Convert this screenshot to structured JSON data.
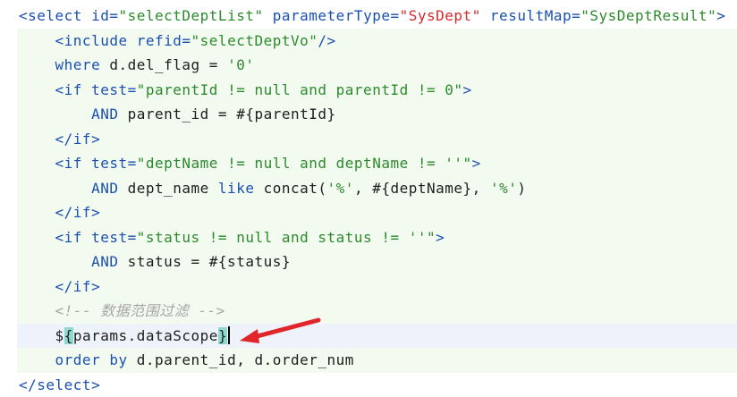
{
  "code": {
    "lines": [
      {
        "segments": [
          {
            "t": "<select ",
            "c": "tag"
          },
          {
            "t": "id=",
            "c": "attr"
          },
          {
            "t": "\"selectDeptList\" ",
            "c": "str"
          },
          {
            "t": "parameterType=",
            "c": "attr"
          },
          {
            "t": "\"SysDept\" ",
            "c": "red"
          },
          {
            "t": "resultMap=",
            "c": "attr"
          },
          {
            "t": "\"SysDeptResult\"",
            "c": "str"
          },
          {
            "t": ">",
            "c": "tag"
          }
        ]
      },
      {
        "segments": [
          {
            "t": "    <include ",
            "c": "tag"
          },
          {
            "t": "refid=",
            "c": "attr"
          },
          {
            "t": "\"selectDeptVo\"",
            "c": "str"
          },
          {
            "t": "/>",
            "c": "tag"
          }
        ]
      },
      {
        "segments": [
          {
            "t": "    where ",
            "c": "kw"
          },
          {
            "t": "d.del_flag = ",
            "c": "plain"
          },
          {
            "t": "'0'",
            "c": "str"
          }
        ]
      },
      {
        "segments": [
          {
            "t": "    <if ",
            "c": "tag"
          },
          {
            "t": "test=",
            "c": "attr"
          },
          {
            "t": "\"parentId != null and parentId != 0\"",
            "c": "str"
          },
          {
            "t": ">",
            "c": "tag"
          }
        ]
      },
      {
        "segments": [
          {
            "t": "        AND ",
            "c": "kw"
          },
          {
            "t": "parent_id = #{parentId}",
            "c": "plain"
          }
        ]
      },
      {
        "segments": [
          {
            "t": "    </if>",
            "c": "tag"
          }
        ]
      },
      {
        "segments": [
          {
            "t": "    <if ",
            "c": "tag"
          },
          {
            "t": "test=",
            "c": "attr"
          },
          {
            "t": "\"deptName != null and deptName != ''\"",
            "c": "str"
          },
          {
            "t": ">",
            "c": "tag"
          }
        ]
      },
      {
        "segments": [
          {
            "t": "        AND ",
            "c": "kw"
          },
          {
            "t": "dept_name ",
            "c": "plain"
          },
          {
            "t": "like ",
            "c": "kw"
          },
          {
            "t": "concat(",
            "c": "plain"
          },
          {
            "t": "'%'",
            "c": "str"
          },
          {
            "t": ", #{deptName}, ",
            "c": "plain"
          },
          {
            "t": "'%'",
            "c": "str"
          },
          {
            "t": ")",
            "c": "plain"
          }
        ]
      },
      {
        "segments": [
          {
            "t": "    </if>",
            "c": "tag"
          }
        ]
      },
      {
        "segments": [
          {
            "t": "    <if ",
            "c": "tag"
          },
          {
            "t": "test=",
            "c": "attr"
          },
          {
            "t": "\"status != null and status != ''\"",
            "c": "str"
          },
          {
            "t": ">",
            "c": "tag"
          }
        ]
      },
      {
        "segments": [
          {
            "t": "        AND ",
            "c": "kw"
          },
          {
            "t": "status = #{status}",
            "c": "plain"
          }
        ]
      },
      {
        "segments": [
          {
            "t": "    </if>",
            "c": "tag"
          }
        ]
      },
      {
        "segments": [
          {
            "t": "    <!-- 数据范围过滤 -->",
            "c": "cmt"
          }
        ]
      },
      {
        "segments": [
          {
            "t": "    $",
            "c": "plain"
          },
          {
            "t": "{",
            "c": "plain",
            "hl": true
          },
          {
            "t": "params.dataScope",
            "c": "plain"
          },
          {
            "t": "}",
            "c": "plain",
            "hl": true
          }
        ],
        "current": true,
        "caret": true
      },
      {
        "segments": [
          {
            "t": "    order by ",
            "c": "kw"
          },
          {
            "t": "d.parent_id, d.order_num",
            "c": "plain"
          }
        ]
      },
      {
        "segments": [
          {
            "t": "</select>",
            "c": "tag"
          }
        ]
      }
    ]
  },
  "colors": {
    "tag": "#1a4fb0",
    "string": "#2b8a2b",
    "type_value": "#d42a2a",
    "comment": "#a6a6a6",
    "brace_highlight": "#8fd8cf",
    "arrow": "#e0262b"
  }
}
